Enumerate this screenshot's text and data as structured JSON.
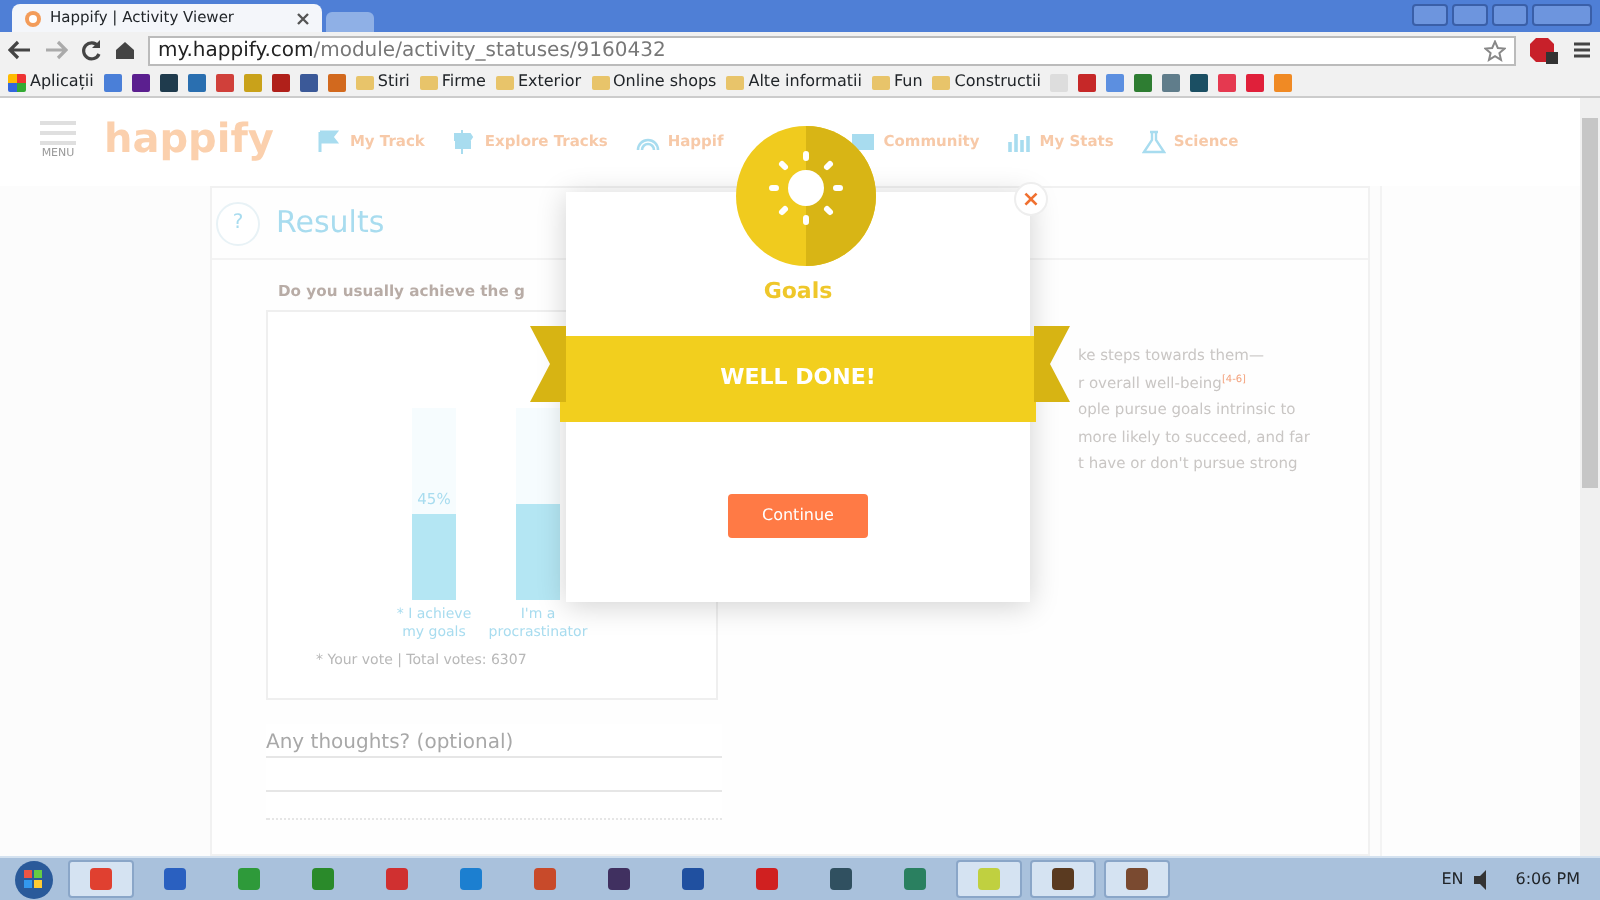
{
  "browser": {
    "tab_title": "Happify | Activity Viewer",
    "url_host": "my.happify.com",
    "url_path": "/module/activity_statuses/9160432",
    "bookmarks": [
      {
        "kind": "apps",
        "label": "Aplicații"
      },
      {
        "kind": "site",
        "color": "#4a7fd8"
      },
      {
        "kind": "site",
        "color": "#5b1f8f"
      },
      {
        "kind": "site",
        "color": "#1f3b4d"
      },
      {
        "kind": "site",
        "color": "#2a6fb0"
      },
      {
        "kind": "site",
        "color": "#d0403a"
      },
      {
        "kind": "site",
        "color": "#c9a21a"
      },
      {
        "kind": "site",
        "color": "#b0201a"
      },
      {
        "kind": "site",
        "color": "#3b5998"
      },
      {
        "kind": "site",
        "color": "#d2691e"
      },
      {
        "kind": "folder",
        "label": "Stiri"
      },
      {
        "kind": "folder",
        "label": "Firme"
      },
      {
        "kind": "folder",
        "label": "Exterior"
      },
      {
        "kind": "folder",
        "label": "Online shops"
      },
      {
        "kind": "folder",
        "label": "Alte informatii"
      },
      {
        "kind": "folder",
        "label": "Fun"
      },
      {
        "kind": "folder",
        "label": "Constructii"
      },
      {
        "kind": "site",
        "color": "#dddddd"
      },
      {
        "kind": "site",
        "color": "#c62828"
      },
      {
        "kind": "site",
        "color": "#5c8fe0"
      },
      {
        "kind": "site",
        "color": "#2e7d32"
      },
      {
        "kind": "site",
        "color": "#607d8b"
      },
      {
        "kind": "site",
        "color": "#1b4f63"
      },
      {
        "kind": "site",
        "color": "#e53950"
      },
      {
        "kind": "site",
        "color": "#e0203a"
      },
      {
        "kind": "site",
        "color": "#f08a24"
      }
    ]
  },
  "site": {
    "menu_label": "MENU",
    "logo": "happify",
    "nav": [
      {
        "label": "My Track"
      },
      {
        "label": "Explore Tracks"
      },
      {
        "label": "Happif"
      },
      {
        "label": "Community"
      },
      {
        "label": "My Stats"
      },
      {
        "label": "Science"
      }
    ]
  },
  "results": {
    "help": "?",
    "title": "Results",
    "question": "Do you usually achieve the g",
    "options": [
      {
        "percent": "45%",
        "level": 0.45,
        "label": "* I achieve my goals"
      },
      {
        "level": 0.5,
        "label": "I'm a procrastinator"
      }
    ],
    "footer": "* Your vote | Total votes: 6307",
    "thoughts_placeholder": "Any thoughts? (optional)"
  },
  "article": {
    "lines": [
      "ke steps towards them—",
      "r overall well-being$^{[4-6]}$",
      "ople pursue goals intrinsic to",
      "more likely to succeed, and far",
      "t have or don't pursue strong"
    ]
  },
  "modal": {
    "title": "Goals",
    "banner": "WELL DONE!",
    "button": "Continue",
    "close": "×"
  },
  "taskbar": {
    "apps": [
      {
        "color": "#e04030",
        "selected": true
      },
      {
        "color": "#2a60c0",
        "selected": false
      },
      {
        "color": "#2e9a3a",
        "selected": false
      },
      {
        "color": "#2a8a2a",
        "selected": false
      },
      {
        "color": "#d03030",
        "selected": false
      },
      {
        "color": "#1c7fd0",
        "selected": false
      },
      {
        "color": "#c84a2a",
        "selected": false
      },
      {
        "color": "#403060",
        "selected": false
      },
      {
        "color": "#2050a0",
        "selected": false
      },
      {
        "color": "#d02020",
        "selected": false
      },
      {
        "color": "#305060",
        "selected": false
      },
      {
        "color": "#2a8060",
        "selected": false
      },
      {
        "color": "#c0d040",
        "selected": true
      },
      {
        "color": "#5a3a20",
        "selected": true
      },
      {
        "color": "#7a4a30",
        "selected": true
      }
    ],
    "language": "EN",
    "clock": "6:06 PM"
  }
}
